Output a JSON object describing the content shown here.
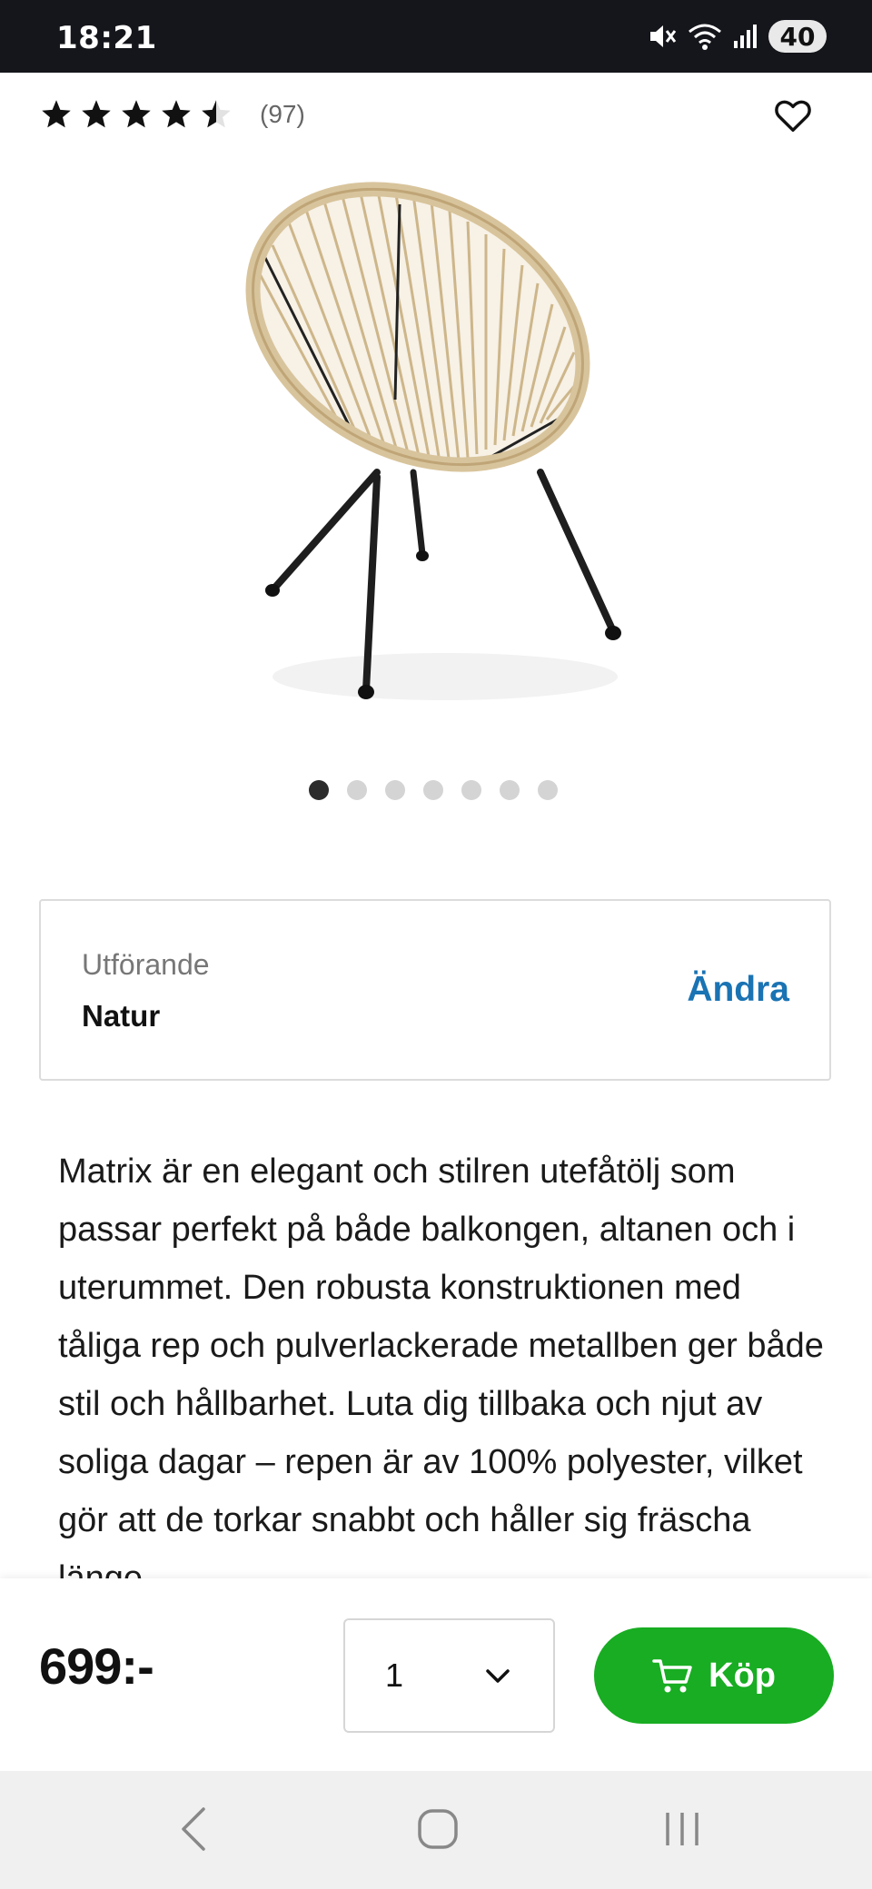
{
  "status_bar": {
    "time": "18:21",
    "battery": "40",
    "icons": [
      "mute-icon",
      "wifi-icon",
      "signal-icon",
      "battery-icon"
    ]
  },
  "product": {
    "rating_count": "(97)",
    "rating": 4.5,
    "rating_max": 5,
    "image_index": 1,
    "image_count": 7,
    "image_alt": "chair"
  },
  "variant": {
    "label": "Utförande",
    "value": "Natur",
    "change_label": "Ändra"
  },
  "description": "Matrix är en elegant och stilren utefåtölj som passar perfekt på både balkongen, altanen och i uterummet. Den robusta konstruktionen med tåliga rep och pulverlackerade metallben ger både stil och hållbarhet. Luta dig tillbaka och njut av soliga dagar – repen är av 100% polyester, vilket gör att de torkar snabbt och håller sig fräscha länge.",
  "purchase": {
    "price": "699:-",
    "quantity": "1",
    "buy_label": "Köp"
  },
  "colors": {
    "accent_link": "#1a73b3",
    "buy_button": "#18ad22",
    "status_bar": "#15161b"
  }
}
